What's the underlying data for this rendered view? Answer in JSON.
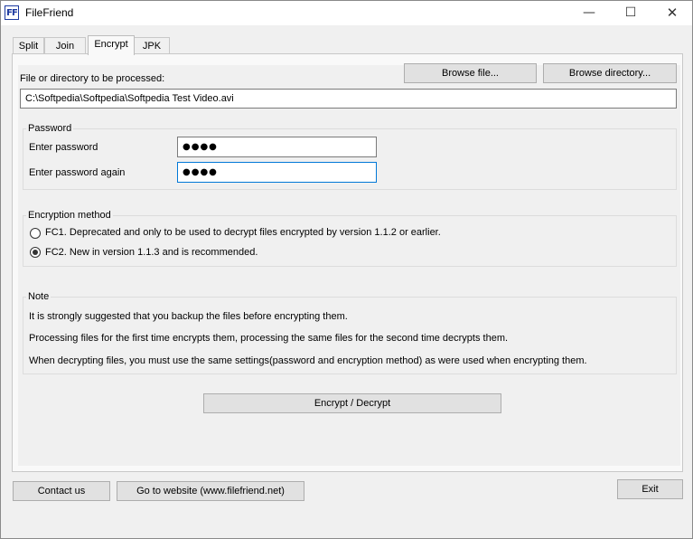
{
  "window": {
    "title": "FileFriend",
    "icon_text": "FF",
    "controls": {
      "minimize": "—",
      "maximize": "☐",
      "close": "✕"
    }
  },
  "tabs": [
    {
      "label": "Split"
    },
    {
      "label": "Join"
    },
    {
      "label": "Encrypt"
    },
    {
      "label": "JPK"
    }
  ],
  "active_tab": "Encrypt",
  "file": {
    "label": "File or directory to be processed:",
    "browse_file_label": "Browse file...",
    "browse_dir_label": "Browse directory...",
    "path_value": "C:\\Softpedia\\Softpedia\\Softpedia Test Video.avi"
  },
  "password": {
    "group_title": "Password",
    "enter_label": "Enter password",
    "enter_value": "●●●●",
    "again_label": "Enter password again",
    "again_value": "●●●●"
  },
  "encryption": {
    "group_title": "Encryption method",
    "options": [
      {
        "label": "FC1. Deprecated and only to be used to decrypt files encrypted by version 1.1.2 or earlier.",
        "checked": false
      },
      {
        "label": "FC2. New in version 1.1.3 and is recommended.",
        "checked": true
      }
    ]
  },
  "note": {
    "group_title": "Note",
    "lines": [
      "It is strongly suggested that you backup the files before encrypting them.",
      "Processing files for the first time encrypts them, processing the same files for the second time decrypts them.",
      "When decrypting files, you must use the same settings(password  and encryption method) as were used when encrypting them."
    ]
  },
  "actions": {
    "encrypt_label": "Encrypt / Decrypt"
  },
  "footer": {
    "contact_label": "Contact us",
    "website_label": "Go to website (www.filefriend.net)",
    "exit_label": "Exit"
  }
}
